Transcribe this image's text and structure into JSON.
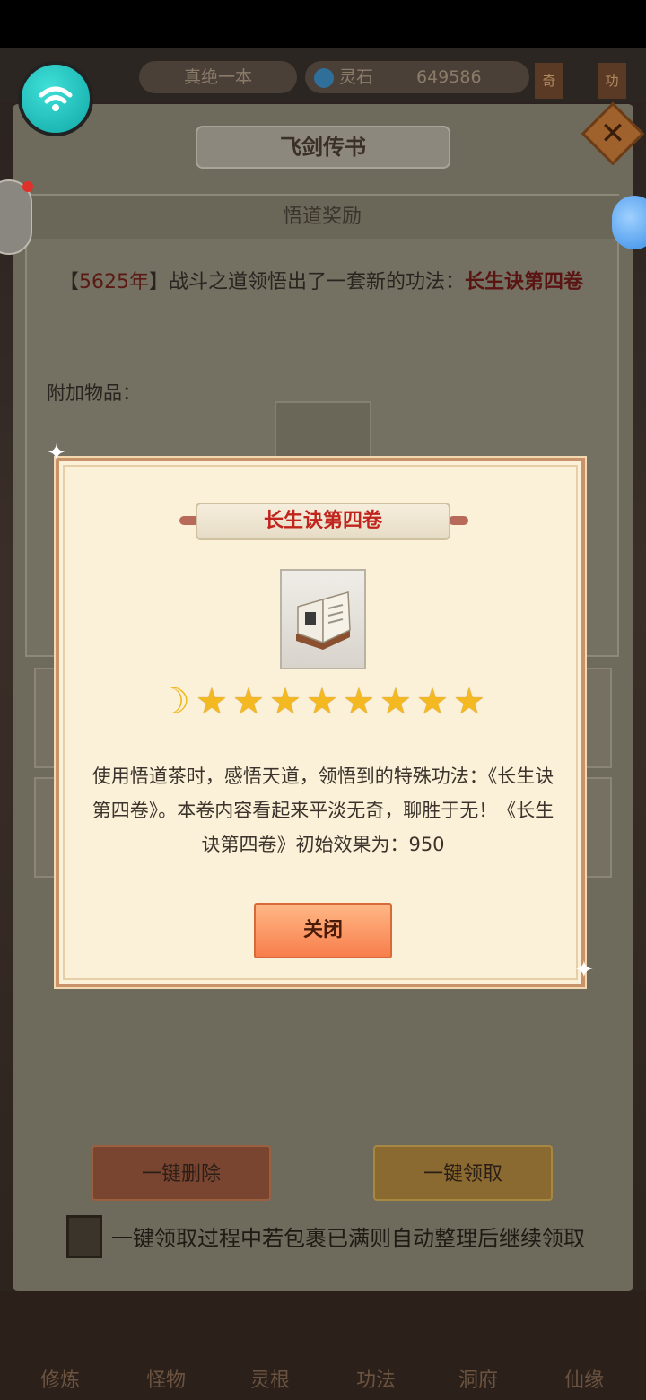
{
  "top_bar": {
    "player_name": "真绝一本",
    "currency_label": "灵石",
    "currency_value": "649586",
    "tag_left": "奇",
    "tag_right": "功"
  },
  "panel": {
    "title": "飞剑传书",
    "section_header": "悟道奖励",
    "reward_prefix": "【",
    "reward_year": "5625年",
    "reward_middle": "】战斗之道领悟出了一套新的功法：",
    "reward_skill": "长生诀第四卷",
    "attach_label": "附加物品：",
    "delete_all_label": "一键删除",
    "claim_all_label": "一键领取",
    "auto_sort_label": "一键领取过程中若包裹已满则自动整理后继续领取"
  },
  "modal": {
    "title": "长生诀第四卷",
    "description": "使用悟道茶时，感悟天道，领悟到的特殊功法：《长生诀第四卷》。本卷内容看起来平淡无奇，聊胜于无！《长生诀第四卷》初始效果为：950",
    "rating": {
      "moons": 1,
      "stars": 8
    },
    "close_label": "关闭"
  },
  "bottom_nav": {
    "items": [
      "修炼",
      "怪物",
      "灵根",
      "功法",
      "洞府",
      "仙缘"
    ]
  },
  "colors": {
    "accent_red": "#c0241c",
    "star_gold": "#f4b820",
    "close_button": "#f77e4c",
    "modal_bg": "#fbf1d8"
  }
}
